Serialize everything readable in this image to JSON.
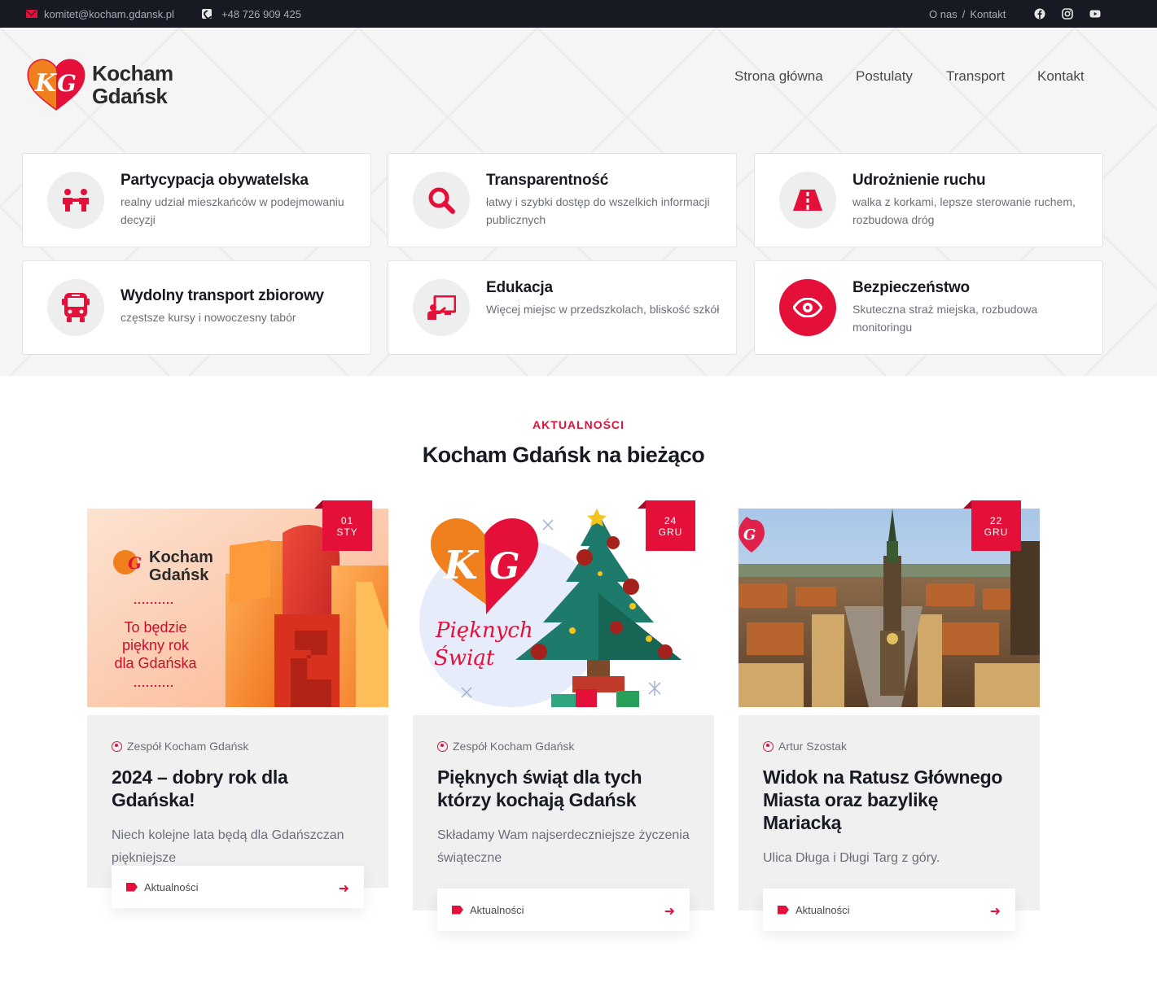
{
  "topbar": {
    "email": "komitet@kocham.gdansk.pl",
    "phone": "+48 726 909 425",
    "links": [
      "O nas",
      "/",
      "Kontakt"
    ],
    "social": [
      "facebook-icon",
      "instagram-icon",
      "youtube-icon"
    ]
  },
  "logo": {
    "line1": "Kocham",
    "line2": "Gdańsk"
  },
  "nav": [
    "Strona główna",
    "Postulaty",
    "Transport",
    "Kontakt"
  ],
  "features": [
    {
      "title": "Partycypacja obywatelska",
      "desc": "realny udział mieszkańców w podejmowaniu decyzji",
      "icon": "people-icon"
    },
    {
      "title": "Transparentność",
      "desc": "łatwy i szybki dostęp do wszelkich informacji publicznych",
      "icon": "search-icon"
    },
    {
      "title": "Udrożnienie ruchu",
      "desc": "walka z korkami, lepsze sterowanie ruchem, rozbudowa dróg",
      "icon": "road-icon"
    },
    {
      "title": "Wydolny transport zbiorowy",
      "desc": "częstsze kursy i nowoczesny tabór",
      "icon": "bus-icon"
    },
    {
      "title": "Edukacja",
      "desc": "Więcej miejsc w przedszkolach, bliskość szkół",
      "icon": "teacher-icon"
    },
    {
      "title": "Bezpieczeństwo",
      "desc": "Skuteczna straż miejska, rozbudowa monitoringu",
      "icon": "eye-icon"
    }
  ],
  "news": {
    "label": "AKTUALNOŚCI",
    "title": "Kocham Gdańsk na bieżąco",
    "posts": [
      {
        "day": "01",
        "month": "STY",
        "author": "Zespół Kocham Gdańsk",
        "title": "2024 – dobry rok dla Gdańska!",
        "excerpt": "Niech kolejne lata będą dla Gdańszczan piękniejsze",
        "category": "Aktualności",
        "image": {
          "line1": "Kocham",
          "line2": "Gdańsk",
          "caption1": "To będzie",
          "caption2": "piękny rok",
          "caption3": "dla Gdańska"
        }
      },
      {
        "day": "24",
        "month": "GRU",
        "author": "Zespół Kocham Gdańsk",
        "title": "Pięknych świąt dla tych którzy kochają Gdańsk",
        "excerpt": "Składamy Wam najserdeczniejsze życzenia świąteczne",
        "category": "Aktualności",
        "image": {
          "line1": "Pięknych",
          "line2": "Świąt"
        }
      },
      {
        "day": "22",
        "month": "GRU",
        "author": "Artur Szostak",
        "title": "Widok na Ratusz Głównego Miasta oraz bazylikę Mariacką",
        "excerpt": "Ulica Długa i Długi Targ z góry.",
        "category": "Aktualności"
      }
    ]
  },
  "colors": {
    "accent": "#e4103a",
    "dark": "#171a23",
    "logo_orange": "#f07f1e"
  }
}
